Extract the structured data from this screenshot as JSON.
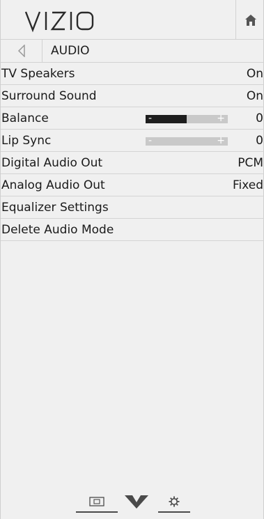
{
  "header": {
    "brand": "VIZIO",
    "home_icon": "home-icon"
  },
  "breadcrumb": {
    "back_icon": "back-arrow-icon",
    "label": "AUDIO"
  },
  "menu": {
    "items": [
      {
        "label": "TV Speakers",
        "value": "On"
      },
      {
        "label": "Surround Sound",
        "value": "On"
      },
      {
        "label": "Balance",
        "value": "0",
        "slider": {
          "minus": "-",
          "plus": "+",
          "level": 0.5
        }
      },
      {
        "label": "Lip Sync",
        "value": "0",
        "slider": {
          "minus": "-",
          "plus": "+",
          "level": 0.0
        }
      },
      {
        "label": "Digital Audio Out",
        "value": "PCM"
      },
      {
        "label": "Analog Audio Out",
        "value": "Fixed"
      },
      {
        "label": "Equalizer Settings"
      },
      {
        "label": "Delete Audio Mode"
      }
    ]
  },
  "bottom_bar": {
    "icons": [
      "input-source-icon",
      "vizio-v-icon",
      "settings-gear-icon"
    ]
  },
  "colors": {
    "panel_bg": "#f0f0f0",
    "divider": "#d4d4d4",
    "text": "#1a1a1a",
    "slider_track": "#c9c9c9",
    "slider_fill": "#1e1e1e"
  }
}
